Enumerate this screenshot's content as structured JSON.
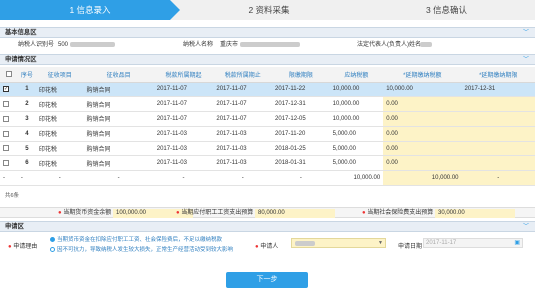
{
  "steps": [
    {
      "label": "1 信息录入"
    },
    {
      "label": "2 资料采集"
    },
    {
      "label": "3 信息确认"
    }
  ],
  "basic": {
    "section_title": "基本信息区",
    "taxpayer_id_label": "纳税人识别号",
    "taxpayer_id_value": "500",
    "taxpayer_name_label": "纳税人名称",
    "taxpayer_name_value": "重庆市",
    "legal_rep_label": "法定代表人(负责人)姓名"
  },
  "apply_info": {
    "section_title": "申请情况区",
    "columns": [
      "序号",
      "征收项目",
      "征收品目",
      "税款所属期起",
      "税款所属期止",
      "限缴期限",
      "应纳税额",
      "*延期缴纳税额",
      "*延期缴纳期限"
    ],
    "rows": [
      {
        "no": "1",
        "item": "印花税",
        "sub": "购销合同",
        "start": "2017-11-07",
        "end": "2017-11-07",
        "deadline": "2017-11-22",
        "due": "10,000.00",
        "defer": "10,000.00",
        "defer_date": "2017-12-31",
        "checked": true
      },
      {
        "no": "2",
        "item": "印花税",
        "sub": "购销合同",
        "start": "2017-11-07",
        "end": "2017-11-07",
        "deadline": "2017-12-31",
        "due": "10,000.00",
        "defer": "0.00",
        "defer_date": "",
        "checked": false
      },
      {
        "no": "3",
        "item": "印花税",
        "sub": "购销合同",
        "start": "2017-11-07",
        "end": "2017-11-07",
        "deadline": "2017-12-05",
        "due": "10,000.00",
        "defer": "0.00",
        "defer_date": "",
        "checked": false
      },
      {
        "no": "4",
        "item": "印花税",
        "sub": "购销合同",
        "start": "2017-11-03",
        "end": "2017-11-03",
        "deadline": "2017-11-20",
        "due": "5,000.00",
        "defer": "0.00",
        "defer_date": "",
        "checked": false
      },
      {
        "no": "5",
        "item": "印花税",
        "sub": "购销合同",
        "start": "2017-11-03",
        "end": "2017-11-03",
        "deadline": "2018-01-25",
        "due": "5,000.00",
        "defer": "0.00",
        "defer_date": "",
        "checked": false
      },
      {
        "no": "6",
        "item": "印花税",
        "sub": "购销合同",
        "start": "2017-11-03",
        "end": "2017-11-03",
        "deadline": "2018-01-31",
        "due": "5,000.00",
        "defer": "0.00",
        "defer_date": "",
        "checked": false
      }
    ],
    "summary_row": {
      "dash": "-",
      "due": "10,000.00",
      "defer": "10,000.00",
      "defer_date": "-"
    },
    "count": "共6条",
    "totals": {
      "cash_label": "当期货币资金余额",
      "cash_value": "100,000.00",
      "wage_label": "当期应付职工工资支出预算",
      "wage_value": "80,000.00",
      "social_label": "当期社会保险费支出预算",
      "social_value": "30,000.00"
    }
  },
  "applicant": {
    "section_title": "申请区",
    "reason_label": "申请理由",
    "reason_opt1": "当期货币资金在扣除应付职工工资、社会保险费后，不足以缴纳税款",
    "reason_opt2": "因不可抗力，导致纳税人发生较大损失，正常生产经营活动受到较大影响",
    "applicant_label": "申请人",
    "date_label": "申请日期",
    "date_value": "2017-11-17"
  },
  "next_button": "下一步",
  "colors": {
    "accent": "#2f9fe6",
    "highlight": "#fdf3c7",
    "selected": "#cce5f8"
  }
}
